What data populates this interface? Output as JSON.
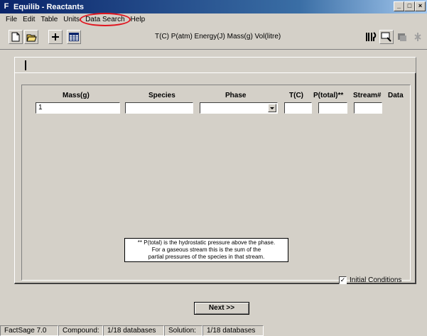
{
  "window": {
    "app_icon_glyph": "F",
    "title": "Equilib - Reactants",
    "controls": {
      "minimize": "_",
      "maximize": "□",
      "close": "×"
    }
  },
  "menu": {
    "items": [
      "File",
      "Edit",
      "Table",
      "Units",
      "Data Search",
      "Help"
    ],
    "highlighted": "Data Search",
    "highlight_color": "#e0141e"
  },
  "toolbar": {
    "left_icons": [
      "new-document-icon",
      "open-folder-icon",
      "add-icon",
      "table-icon"
    ],
    "right_icons": [
      "reaction-tools-icon",
      "display-icon",
      "parameter-icon",
      "wizard-icon"
    ],
    "units": "T(C) P(atm) Energy(J) Mass(g) Vol(litre)"
  },
  "table": {
    "headers": {
      "mass": "Mass(g)",
      "species": "Species",
      "phase": "Phase",
      "temp": "T(C)",
      "ptotal": "P(total)**",
      "stream": "Stream#",
      "data": "Data"
    },
    "row": {
      "mass": "1",
      "species": "",
      "phase": "",
      "temp": "",
      "ptotal": "",
      "stream": ""
    }
  },
  "note": {
    "line1": "** P(total) is the hydrostatic pressure above the phase.",
    "line2": "For a gaseous stream this is the sum of the",
    "line3": "partial pressures of the species in that stream."
  },
  "options": {
    "initial_conditions_label": "Initial Conditions",
    "initial_conditions_checked": true,
    "check_glyph": "✓"
  },
  "actions": {
    "next_label": "Next >>"
  },
  "status": {
    "version": "FactSage 7.0",
    "compound_label": "Compound:",
    "compound_value": "1/18 databases",
    "solution_label": "Solution:",
    "solution_value": "1/18 databases"
  }
}
